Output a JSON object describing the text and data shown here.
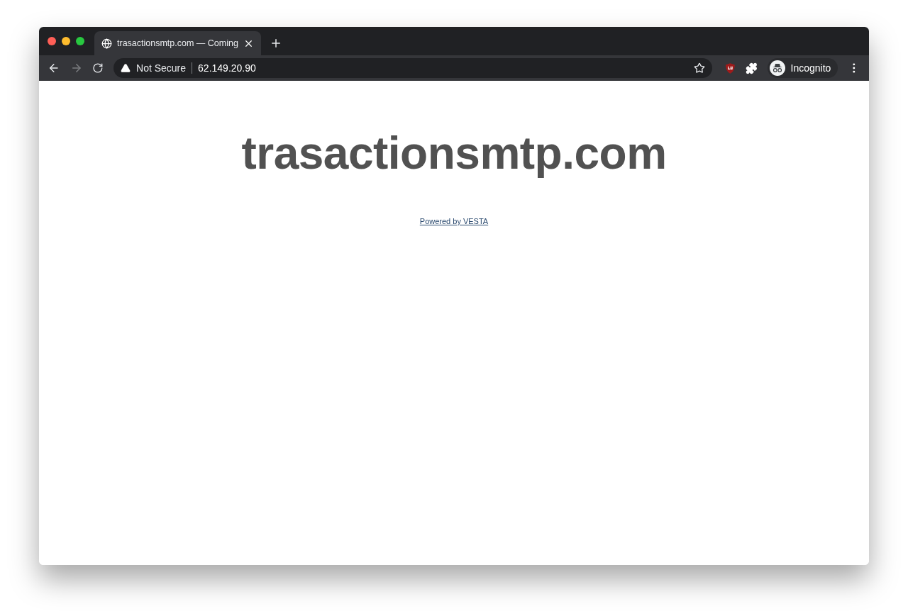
{
  "tabs": [
    {
      "title": "trasactionsmtp.com — Coming",
      "selected": true
    }
  ],
  "address_bar": {
    "security_label": "Not Secure",
    "url": "62.149.20.90"
  },
  "profile": {
    "label": "Incognito"
  },
  "page": {
    "heading": "trasactionsmtp.com",
    "link": "Powered by VESTA"
  }
}
